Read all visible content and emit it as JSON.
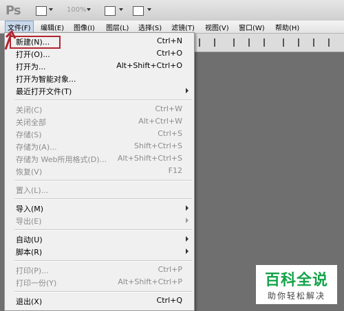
{
  "app": {
    "logo": "Ps",
    "zoom": "100%"
  },
  "colors": {
    "accent": "#b0242f",
    "watermark_green": "#14a34a"
  },
  "menubar": {
    "items": [
      {
        "label": "文件(F)"
      },
      {
        "label": "编辑(E)"
      },
      {
        "label": "图像(I)"
      },
      {
        "label": "图层(L)"
      },
      {
        "label": "选择(S)"
      },
      {
        "label": "滤镜(T)"
      },
      {
        "label": "视图(V)"
      },
      {
        "label": "窗口(W)"
      },
      {
        "label": "帮助(H)"
      }
    ]
  },
  "file_menu": {
    "items": [
      {
        "label": "新建(N)...",
        "shortcut": "Ctrl+N"
      },
      {
        "label": "打开(O)...",
        "shortcut": "Ctrl+O"
      },
      {
        "label": "打开为...",
        "shortcut": "Alt+Shift+Ctrl+O"
      },
      {
        "label": "打开为智能对象...",
        "shortcut": ""
      },
      {
        "label": "最近打开文件(T)",
        "shortcut": ""
      },
      {
        "label": "关闭(C)",
        "shortcut": "Ctrl+W"
      },
      {
        "label": "关闭全部",
        "shortcut": "Alt+Ctrl+W"
      },
      {
        "label": "存储(S)",
        "shortcut": "Ctrl+S"
      },
      {
        "label": "存储为(A)...",
        "shortcut": "Shift+Ctrl+S"
      },
      {
        "label": "存储为 Web所用格式(D)...",
        "shortcut": "Alt+Shift+Ctrl+S"
      },
      {
        "label": "恢复(V)",
        "shortcut": "F12"
      },
      {
        "label": "置入(L)...",
        "shortcut": ""
      },
      {
        "label": "导入(M)",
        "shortcut": ""
      },
      {
        "label": "导出(E)",
        "shortcut": ""
      },
      {
        "label": "自动(U)",
        "shortcut": ""
      },
      {
        "label": "脚本(R)",
        "shortcut": ""
      },
      {
        "label": "打印(P)...",
        "shortcut": "Ctrl+P"
      },
      {
        "label": "打印一份(Y)",
        "shortcut": "Alt+Shift+Ctrl+P"
      },
      {
        "label": "退出(X)",
        "shortcut": "Ctrl+Q"
      }
    ]
  },
  "watermark": {
    "title": "百科全说",
    "subtitle": "助你轻松解决"
  }
}
